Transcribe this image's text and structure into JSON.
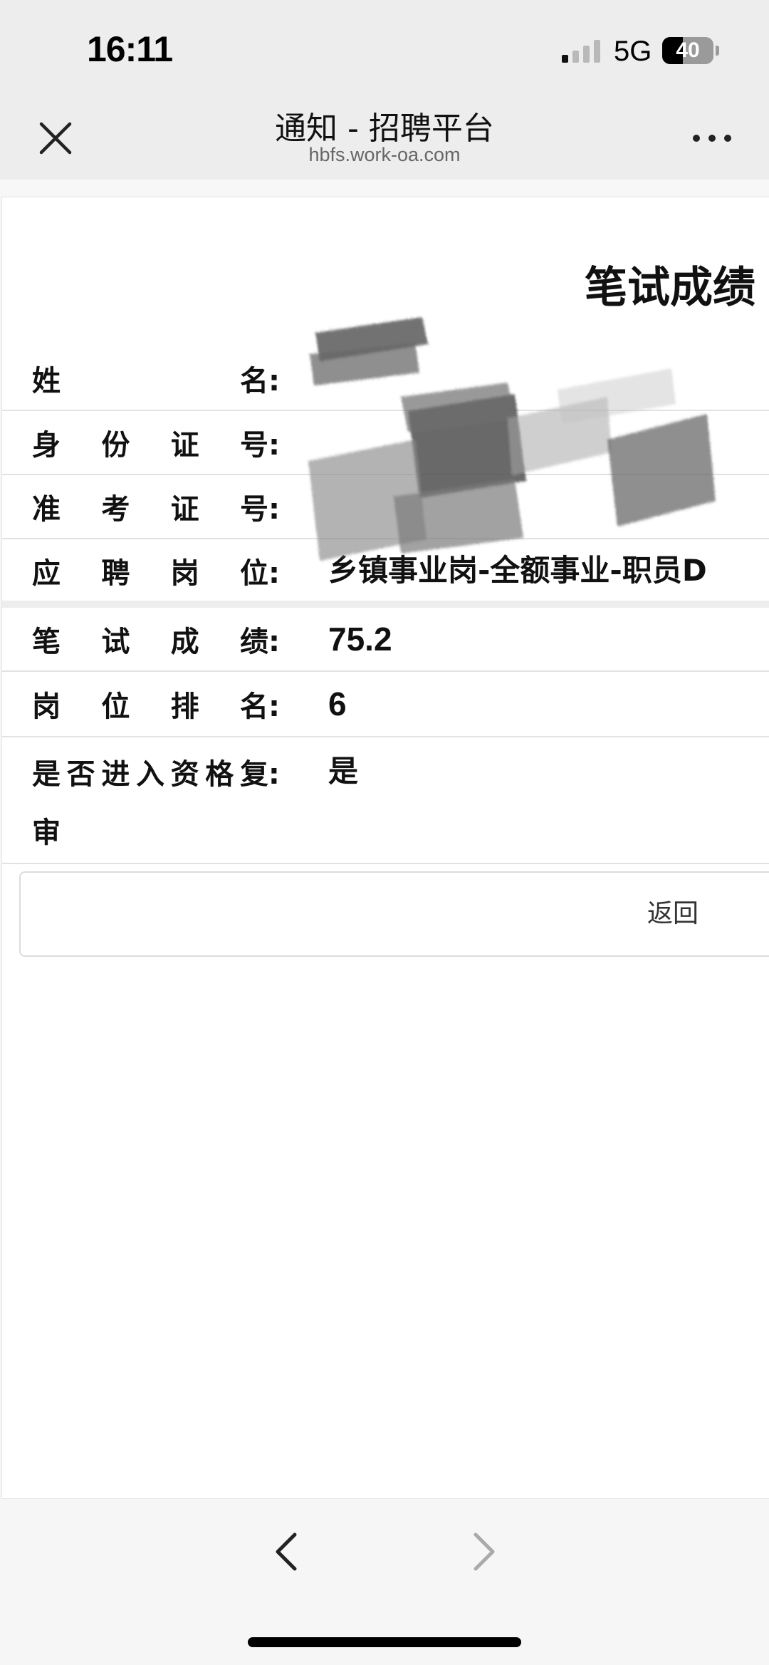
{
  "status_bar": {
    "time": "16:11",
    "network": "5G",
    "battery_level": "40",
    "battery_fraction": 0.4
  },
  "nav": {
    "title": "通知 - 招聘平台",
    "url": "hbfs.work-oa.com",
    "close_icon": "close-icon",
    "more_icon": "more-dots-icon"
  },
  "page": {
    "title": "笔试成绩",
    "fields": [
      {
        "label_chars": [
          "姓",
          "名:"
        ],
        "value": ""
      },
      {
        "label_chars": [
          "身",
          "份",
          "证",
          "号:"
        ],
        "value": ""
      },
      {
        "label_chars": [
          "准",
          "考",
          "证",
          "号:"
        ],
        "value": ""
      },
      {
        "label_chars": [
          "应",
          "聘",
          "岗",
          "位:"
        ],
        "value": "乡镇事业岗-全额事业-职员D"
      },
      {
        "label_chars": [
          "笔",
          "试",
          "成",
          "绩:"
        ],
        "value": "75.2"
      },
      {
        "label_chars": [
          "岗",
          "位",
          "排",
          "名:"
        ],
        "value": "6"
      },
      {
        "label_chars": [
          "是",
          "否",
          "进",
          "入",
          "资",
          "格",
          "复:"
        ],
        "label_line2": "审",
        "value": "是"
      }
    ],
    "back_button": "返回"
  },
  "toolbar": {
    "back_icon": "chevron-left-icon",
    "forward_icon": "chevron-right-icon"
  },
  "colors": {
    "top_bar_bg": "#ededed",
    "page_bg": "#ffffff",
    "toolbar_bg": "#f6f6f6",
    "text": "#111111",
    "muted": "#666666"
  }
}
